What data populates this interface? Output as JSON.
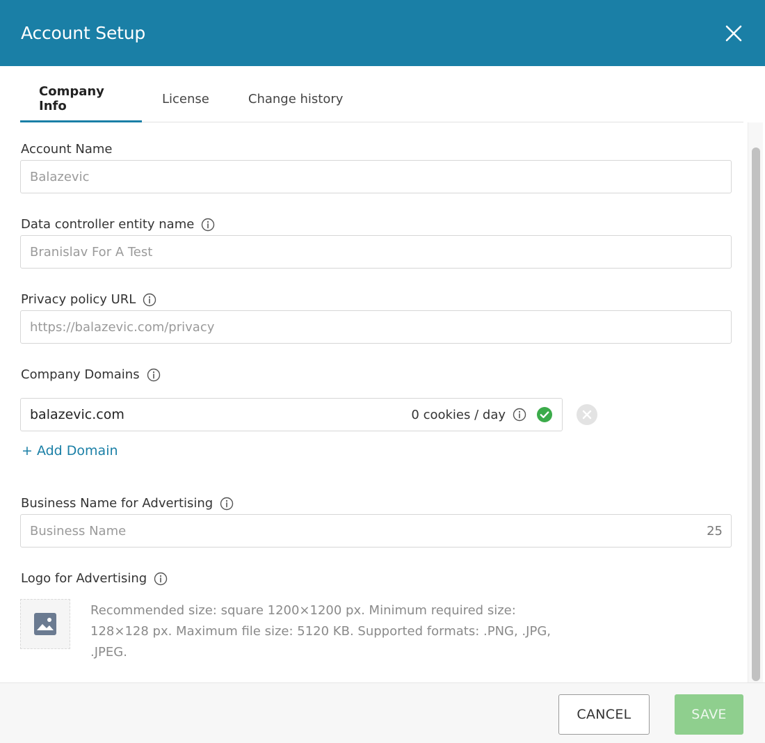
{
  "dialog": {
    "title": "Account Setup",
    "close_icon": "close-icon",
    "header_color": "#1a7fa6"
  },
  "tabs": [
    {
      "label": "Company Info",
      "active": true
    },
    {
      "label": "License",
      "active": false
    },
    {
      "label": "Change history",
      "active": false
    }
  ],
  "form": {
    "account_name": {
      "label": "Account Name",
      "value": "Balazevic"
    },
    "data_controller": {
      "label": "Data controller entity name",
      "value": "Branislav For A Test",
      "info_icon": "info-icon"
    },
    "privacy_policy": {
      "label": "Privacy policy URL",
      "value": "https://balazevic.com/privacy",
      "info_icon": "info-icon"
    },
    "company_domains": {
      "label": "Company Domains",
      "info_icon": "info-icon",
      "domains": [
        {
          "value": "balazevic.com",
          "cookies": "0 cookies / day",
          "status_icon": "check-circle-icon",
          "remove_icon": "remove-circle-icon"
        }
      ],
      "add_label": "+ Add Domain"
    },
    "business_name": {
      "label": "Business Name for Advertising",
      "placeholder": "Business Name",
      "counter": "25",
      "info_icon": "info-icon"
    },
    "logo": {
      "label": "Logo for Advertising",
      "info_icon": "info-icon",
      "placeholder_icon": "image-icon",
      "help_text": "Recommended size: square 1200×1200 px. Minimum required size: 128×128 px. Maximum file size: 5120 KB. Supported formats: .PNG, .JPG, .JPEG."
    }
  },
  "footer": {
    "cancel_label": "CANCEL",
    "save_label": "SAVE",
    "save_color": "#8fcf8e"
  }
}
